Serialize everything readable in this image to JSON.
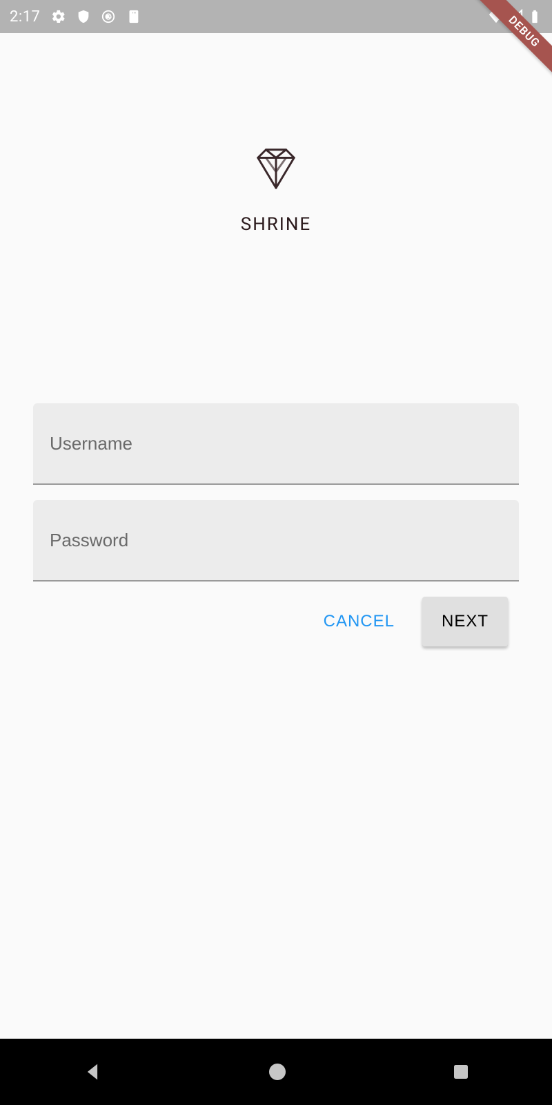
{
  "statusbar": {
    "time": "2:17"
  },
  "debug_banner": "DEBUG",
  "brand": {
    "name": "SHRINE"
  },
  "form": {
    "username": {
      "placeholder": "Username",
      "value": ""
    },
    "password": {
      "placeholder": "Password",
      "value": ""
    }
  },
  "buttons": {
    "cancel": "CANCEL",
    "next": "NEXT"
  }
}
